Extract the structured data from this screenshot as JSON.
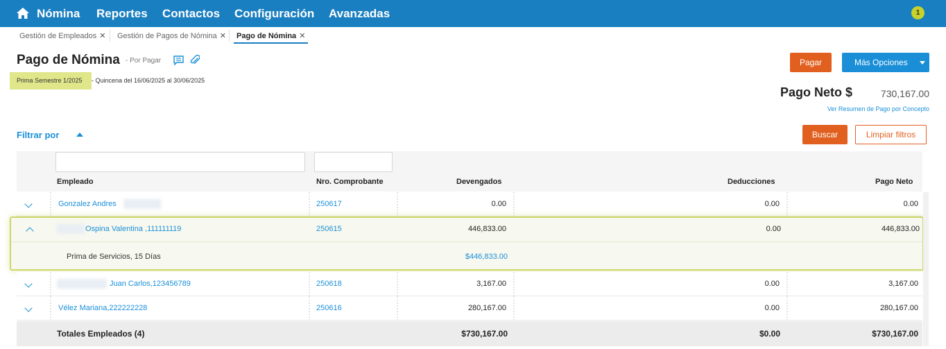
{
  "nav": {
    "items": [
      "Nómina",
      "Reportes",
      "Contactos",
      "Configuración",
      "Avanzadas"
    ],
    "notification_count": "1"
  },
  "tabs": [
    {
      "label": "Gestión de Empleados",
      "active": false
    },
    {
      "label": "Gestión de Pagos de Nómina",
      "active": false
    },
    {
      "label": "Pago de Nómina",
      "active": true
    }
  ],
  "header": {
    "title": "Pago de Nómina",
    "status": "- Por Pagar",
    "period_badge": "Prima Semestre 1/2025",
    "period_desc": "- Quincena del 16/06/2025 al 30/06/2025",
    "pay_button": "Pagar",
    "more_button": "Más Opciones",
    "neto_label": "Pago Neto $",
    "neto_value": "730,167.00",
    "summary_link": "Ver Resumen de Pago por Concepto"
  },
  "filters": {
    "label": "Filtrar por",
    "search_button": "Buscar",
    "clear_button": "Limpiar filtros",
    "employee_value": "",
    "voucher_value": ""
  },
  "table": {
    "columns": [
      "Empleado",
      "Nro. Comprobante",
      "Devengados",
      "Deducciones",
      "Pago Neto"
    ],
    "rows": [
      {
        "employee": "Gonzalez Andres",
        "voucher": "250617",
        "devengados": "0.00",
        "deducciones": "0.00",
        "neto": "0.00"
      },
      {
        "employee": "Ospina Valentina ,111111119",
        "voucher": "250615",
        "devengados": "446,833.00",
        "deducciones": "0.00",
        "neto": "446,833.00"
      },
      {
        "employee": "Juan Carlos,123456789",
        "voucher": "250618",
        "devengados": "3,167.00",
        "deducciones": "0.00",
        "neto": "3,167.00"
      },
      {
        "employee": "Vélez Mariana,222222228",
        "voucher": "250616",
        "devengados": "280,167.00",
        "deducciones": "0.00",
        "neto": "280,167.00"
      }
    ],
    "detail": {
      "concept": "Prima de Servicios, 15 Días",
      "amount": "$446,833.00"
    },
    "totals": {
      "label": "Totales Empleados (4)",
      "devengados": "$730,167.00",
      "deducciones": "$0.00",
      "neto": "$730,167.00"
    }
  },
  "colors": {
    "nav": "#1a7fc1",
    "accent": "#1a8fd8",
    "orange": "#e1601f",
    "highlight": "#dfe78a"
  }
}
